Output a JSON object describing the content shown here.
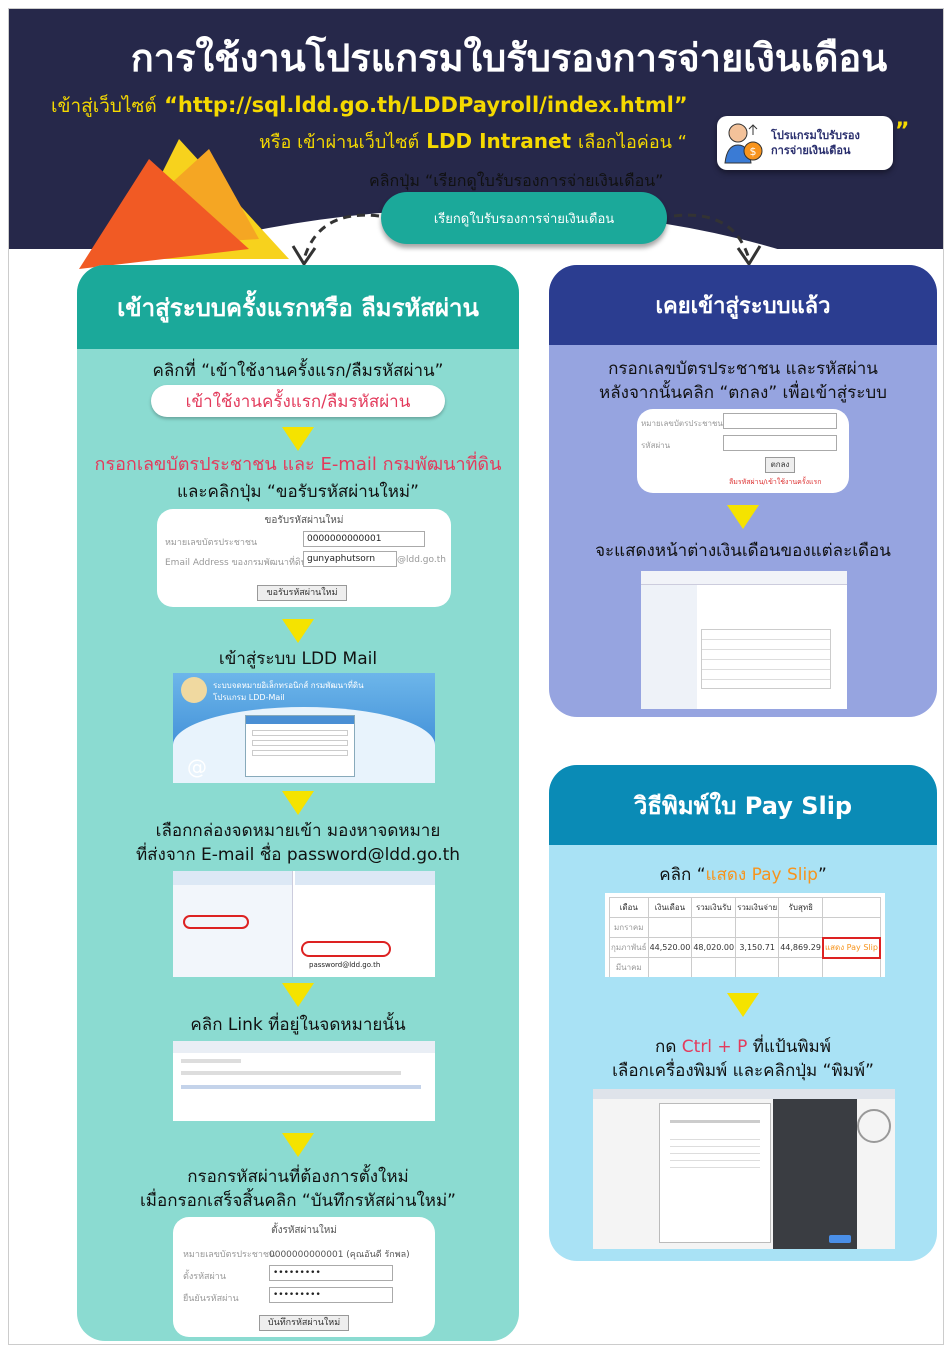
{
  "header": {
    "title": "การใช้งานโปรแกรมใบรับรองการจ่ายเงินเดือน",
    "url_prefix": "เข้าสู่เว็บไซต์",
    "url": "“http://sql.ldd.go.th/LDDPayroll/index.html”",
    "alt_prefix": "หรือ เข้าผ่านเว็บไซต์",
    "alt_site": "LDD Intranet",
    "alt_suffix": "เลือกไอค่อน “",
    "alt_quote_end": "”",
    "icon_label_1": "โปรแกรมใบรับรอง",
    "icon_label_2": "การจ่ายเงินเดือน",
    "click_instruction": "คลิกปุ่ม “เรียกดูใบรับรองการจ่ายเงินเดือน”",
    "main_button": "เรียกดูใบรับรองการจ่ายเงินเดือน"
  },
  "left": {
    "heading": "เข้าสู่ระบบครั้งแรกหรือ ลืมรหัสผ่าน",
    "step1": "คลิกที่ “เข้าใช้งานครั้งแรก/ลืมรหัสผ่าน”",
    "step1_button": "เข้าใช้งานครั้งแรก/ลืมรหัสผ่าน",
    "step2_red": "กรอกเลขบัตรประชาชน และ E-mail กรมพัฒนาที่ดิน",
    "step2": "และคลิกปุ่ม “ขอรับรหัสผ่านใหม่”",
    "form1": {
      "title": "ขอรับรหัสผ่านใหม่",
      "id_label": "หมายเลขบัตรประชาชน",
      "id_value": "0000000000001",
      "email_label": "Email Address ของกรมพัฒนาที่ดิน",
      "email_value": "gunyaphutsorn",
      "email_domain": "@ldd.go.th",
      "submit": "ขอรับรหัสผ่านใหม่"
    },
    "step3": "เข้าสู่ระบบ LDD Mail",
    "mail_title_1": "ระบบจดหมายอิเล็กทรอนิกส์ กรมพัฒนาที่ดิน",
    "mail_title_2": "โปรแกรม LDD-Mail",
    "step4_1": "เลือกกล่องจดหมายเข้า มองหาจดหมาย",
    "step4_2": "ที่ส่งจาก E-mail ชื่อ password@ldd.go.th",
    "inbox_sender": "password@ldd.go.th",
    "step5": "คลิก Link ที่อยู่ในจดหมายนั้น",
    "step6_1": "กรอกรหัสผ่านที่ต้องการตั้งใหม่",
    "step6_2": "เมื่อกรอกเสร็จสิ้นคลิก “บันทึกรหัสผ่านใหม่”",
    "form2": {
      "title": "ตั้งรหัสผ่านใหม่",
      "id_label": "หมายเลขบัตรประชาชน",
      "id_value": "0000000000001 (คุณอันดี รักพล)",
      "pw_label": "ตั้งรหัสผ่าน",
      "pw_value": "•••••••••",
      "confirm_label": "ยืนยันรหัสผ่าน",
      "confirm_value": "•••••••••",
      "submit": "บันทึกรหัสผ่านใหม่"
    }
  },
  "right_top": {
    "heading": "เคยเข้าสู่ระบบแล้ว",
    "step1_1": "กรอกเลขบัตรประชาชน และรหัสผ่าน",
    "step1_2": "หลังจากนั้นคลิก “ตกลง” เพื่อเข้าสู่ระบบ",
    "login": {
      "id_label": "หมายเลขบัตรประชาชน",
      "pw_label": "รหัสผ่าน",
      "submit": "ตกลง",
      "link": "ลืมรหัสผ่าน/เข้าใช้งานครั้งแรก"
    },
    "step2": "จะแสดงหน้าต่างเงินเดือนของแต่ละเดือน"
  },
  "right_bottom": {
    "heading": "วิธีพิมพ์ใบ Pay Slip",
    "step1_prefix": "คลิก “",
    "step1_highlight": "แสดง Pay Slip",
    "step1_suffix": "”",
    "table": {
      "headers": [
        "เดือน",
        "เงินเดือน",
        "รวมเงินรับ",
        "รวมเงินจ่าย",
        "รับสุทธิ",
        ""
      ],
      "rows": [
        [
          "มกราคม",
          "",
          "",
          "",
          "",
          ""
        ],
        [
          "กุมภาพันธ์",
          "44,520.00",
          "48,020.00",
          "3,150.71",
          "44,869.29",
          "แสดง Pay Slip"
        ],
        [
          "มีนาคม",
          "",
          "",
          "",
          "",
          ""
        ]
      ]
    },
    "step2_prefix": "กด ",
    "step2_keys": "Ctrl + P",
    "step2_suffix": " ที่แป้นพิมพ์",
    "step3": "เลือกเครื่องพิมพ์ และคลิกปุ่ม “พิมพ์”"
  }
}
